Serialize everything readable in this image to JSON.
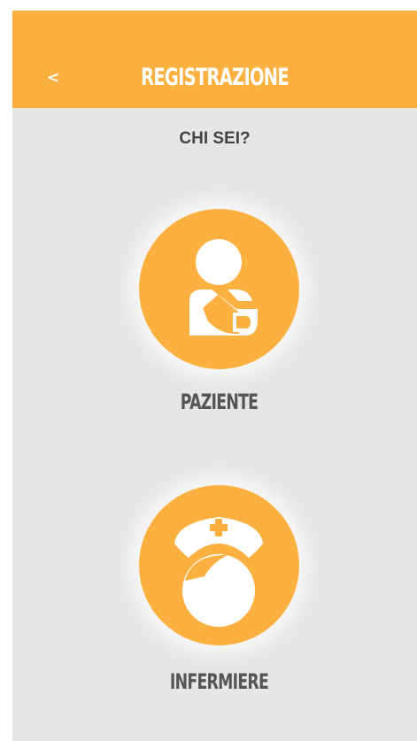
{
  "header": {
    "back_label": "<",
    "title": "REGISTRAZIONE"
  },
  "main": {
    "question": "CHI SEI?",
    "options": [
      {
        "label": "PAZIENTE",
        "icon": "patient-icon"
      },
      {
        "label": "INFERMIERE",
        "icon": "nurse-icon"
      }
    ]
  },
  "colors": {
    "accent": "#fbb040",
    "background": "#e6e6e6",
    "text_dark": "#444444",
    "icon_fill": "#ffffff"
  }
}
